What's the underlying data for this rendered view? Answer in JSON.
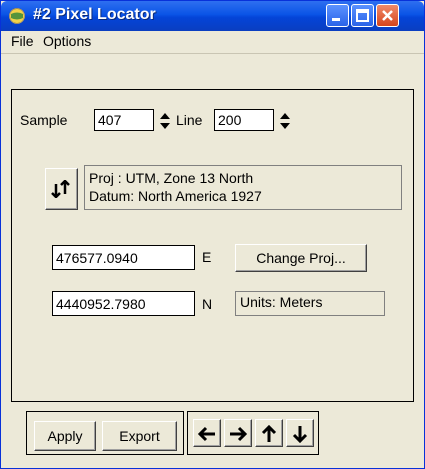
{
  "window": {
    "title": "#2 Pixel Locator"
  },
  "menu": {
    "file": "File",
    "options": "Options"
  },
  "locator": {
    "sample_label": "Sample",
    "sample_value": "407",
    "line_label": "Line",
    "line_value": "200"
  },
  "projection": {
    "proj_text": "Proj : UTM, Zone 13 North",
    "datum_text": "Datum: North America 1927"
  },
  "coords": {
    "easting_value": "476577.0940",
    "easting_label": "E",
    "northing_value": "4440952.7980",
    "northing_label": "N",
    "change_proj_label": "Change Proj...",
    "units_text": "Units: Meters"
  },
  "actions": {
    "apply_label": "Apply",
    "export_label": "Export"
  },
  "icons": {
    "app": "globe-icon",
    "swap": "swap-vertical-icon",
    "left": "arrow-left-icon",
    "right": "arrow-right-icon",
    "up": "arrow-up-icon",
    "down": "arrow-down-icon"
  }
}
